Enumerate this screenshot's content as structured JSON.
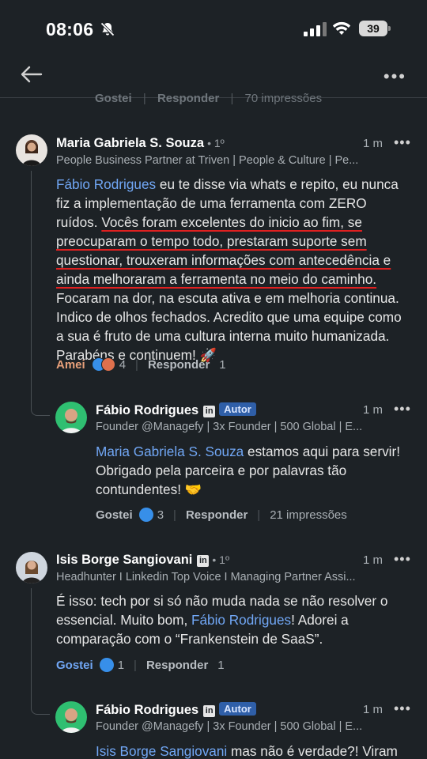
{
  "status_bar": {
    "time": "08:06",
    "battery": "39"
  },
  "previous": {
    "like": "Gostei",
    "reply": "Responder",
    "impressions": "70 impressões"
  },
  "comments": [
    {
      "name": "Maria Gabriela S. Souza",
      "degree": "• 1º",
      "headline": "People Business Partner at Triven | People & Culture | Pe...",
      "time": "1 m",
      "mention": "Fábio Rodrigues",
      "text_before": " eu te disse via whats e repito, eu nunca fiz a implementação de uma ferramenta com ZERO ruídos. ",
      "text_underlined": "Vocês foram excelentes do inicio ao fim, se preocuparam o tempo todo, prestaram suporte sem questionar, trouxeram informações com antecedência e ainda melhoraram a ferramenta no meio do caminho.",
      "text_after": " Focaram na dor, na escuta ativa e em melhoria continua. Indico de olhos fechados. Acredito que uma equipe como a sua é fruto de uma cultura interna muito humanizada. Parabéns e continuem! 🚀",
      "action_like": "Amei",
      "reaction_count": "4",
      "action_reply": "Responder",
      "reply_count": "1"
    },
    {
      "name": "Isis Borge Sangiovani",
      "degree": "• 1º",
      "headline": "Headhunter I Linkedin Top Voice I Managing Partner Assi...",
      "time": "1 m",
      "text_before": "É isso: tech por si só não muda nada se não resolver o essencial. Muito bom, ",
      "mention": "Fábio Rodrigues",
      "text_after": "! Adorei a comparação com o “Frankenstein de SaaS”.",
      "action_like": "Gostei",
      "reaction_count": "1",
      "action_reply": "Responder",
      "reply_count": "1"
    }
  ],
  "replies": [
    {
      "name": "Fábio Rodrigues",
      "badge": "Autor",
      "headline": "Founder @Managefy | 3x Founder | 500 Global | E...",
      "time": "1 m",
      "mention": "Maria Gabriela S. Souza",
      "text": " estamos aqui para servir! Obrigado pela parceira e por palavras tão contundentes! 🤝",
      "action_like": "Gostei",
      "reaction_count": "3",
      "action_reply": "Responder",
      "impressions": "21 impressões"
    },
    {
      "name": "Fábio Rodrigues",
      "badge": "Autor",
      "headline": "Founder @Managefy | 3x Founder | 500 Global | E...",
      "time": "1 m",
      "mention": "Isis Borge Sangiovani",
      "text": " mas não é verdade?! Viram"
    }
  ],
  "colors": {
    "background": "#1d2226",
    "mention": "#71a7f5",
    "underline": "#e02020",
    "author_badge": "#2f5fa8"
  },
  "icons": [
    "bell-slash-icon",
    "signal-icon",
    "wifi-icon",
    "battery-icon",
    "back-arrow-icon",
    "more-icon",
    "linkedin-icon",
    "like-reaction-icon",
    "love-reaction-icon",
    "rocket-emoji",
    "handshake-emoji"
  ]
}
